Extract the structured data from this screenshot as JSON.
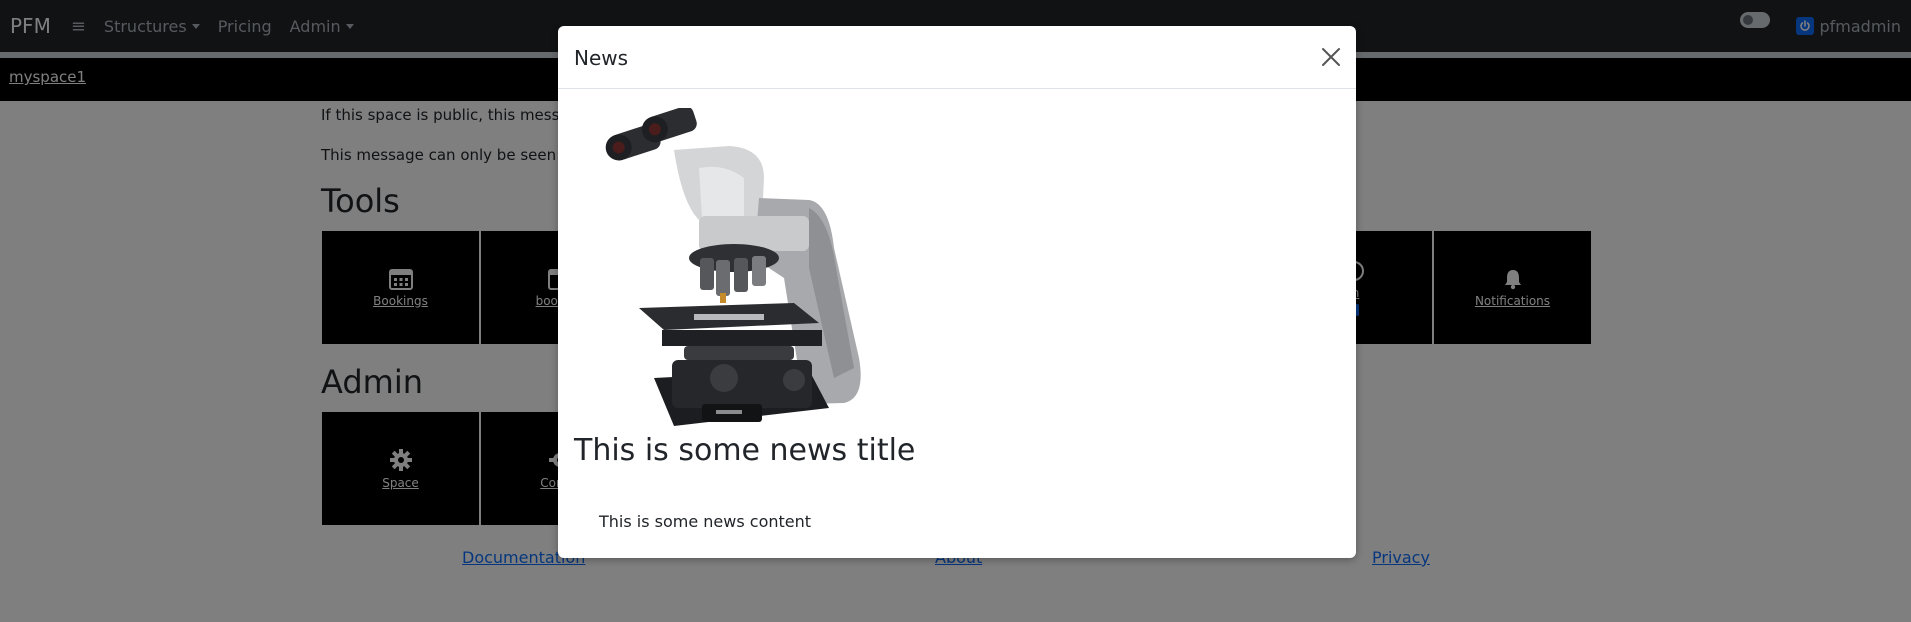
{
  "navbar": {
    "brand": "PFM",
    "menu_icon": "hamburger-icon",
    "items": [
      {
        "label": "Structures",
        "dropdown": true
      },
      {
        "label": "Pricing",
        "dropdown": false
      },
      {
        "label": "Admin",
        "dropdown": true
      }
    ],
    "user": "pfmadmin"
  },
  "space": {
    "name": "myspace1"
  },
  "messages": {
    "public": "If this space is public, this message",
    "private": "This message can only be seen by"
  },
  "tools": {
    "title": "Tools",
    "tiles": [
      {
        "label": "Bookings",
        "icon": "calendar-icon"
      },
      {
        "label": "booking",
        "icon": "calendar-icon"
      },
      {
        "label": "m",
        "icon": "clock-icon"
      },
      {
        "label": "Notifications",
        "icon": "bell-icon"
      }
    ]
  },
  "admin": {
    "title": "Admin",
    "tiles": [
      {
        "label": "Space",
        "icon": "gear-icon"
      },
      {
        "label": "Config",
        "icon": "gear-icon"
      }
    ]
  },
  "footer": {
    "links": [
      "Documentation",
      "About",
      "Privacy"
    ]
  },
  "modal": {
    "title": "News",
    "news_title": "This is some news title",
    "news_content": "This is some news content",
    "image": "microscope-image"
  },
  "colors": {
    "navbar_bg": "#212529",
    "tile_bg": "#000000",
    "link": "#0d6efd",
    "backdrop": "rgba(0,0,0,0.5)"
  }
}
